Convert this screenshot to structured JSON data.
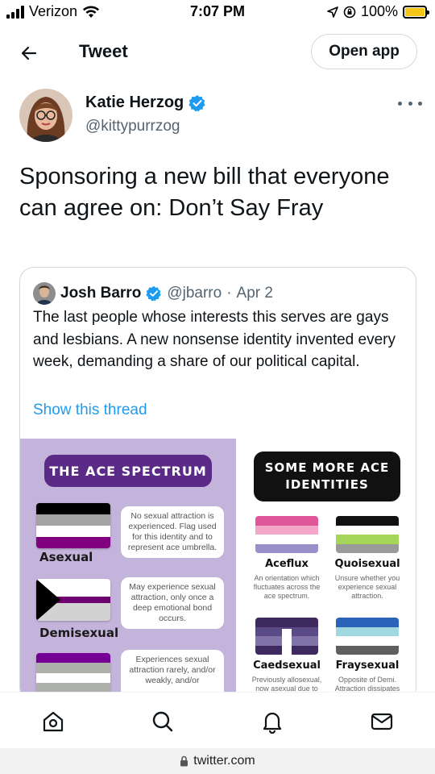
{
  "status_bar": {
    "carrier": "Verizon",
    "time": "7:07 PM",
    "battery_pct": "100%",
    "battery_level": 1.0
  },
  "header": {
    "title": "Tweet",
    "open_app_label": "Open app",
    "back_icon": "arrow-left-icon"
  },
  "tweet": {
    "author_name": "Katie Herzog",
    "author_handle": "@kittypurrzog",
    "text": "Sponsoring a new bill that everyone can agree on: Don’t Say Fray"
  },
  "quoted_tweet": {
    "author_name": "Josh Barro",
    "author_handle": "@jbarro",
    "separator": "·",
    "date": "Apr 2",
    "text": "The last people whose interests this serves are gays and lesbians. A new nonsense identity invented every week, demanding a share of our political capital.",
    "show_thread": "Show this thread",
    "image": {
      "left_title": "THE ACE SPECTRUM",
      "identities": [
        {
          "name": "Asexual",
          "desc": "No sexual attraction is experienced. Flag used for this identity and to represent ace umbrella."
        },
        {
          "name": "Demisexual",
          "desc": "May experience sexual attraction, only once a deep emotional bond occurs."
        },
        {
          "name": "",
          "desc": "Experiences sexual attraction rarely, and/or weakly, and/or"
        }
      ],
      "right_title": "SOME MORE ACE IDENTITIES",
      "more_identities": [
        {
          "name": "Aceflux",
          "desc": "An orientation which fluctuates across the ace spectrum."
        },
        {
          "name": "Quoisexual",
          "desc": "Unsure whether you experience sexual attraction."
        },
        {
          "name": "Caedsexual",
          "desc": "Previously allosexual, now asexual due to"
        },
        {
          "name": "Fraysexual",
          "desc": "Opposite of Demi. Attraction dissipates"
        }
      ]
    }
  },
  "bottom_nav": {
    "items": [
      "home-icon",
      "search-icon",
      "notifications-icon",
      "messages-icon"
    ]
  },
  "url_bar": {
    "url": "twitter.com"
  },
  "colors": {
    "accent": "#1d9bf0",
    "secondary_text": "#536471",
    "ace_purple": "#5a2a86",
    "panel_lavender": "#c4b3db"
  }
}
